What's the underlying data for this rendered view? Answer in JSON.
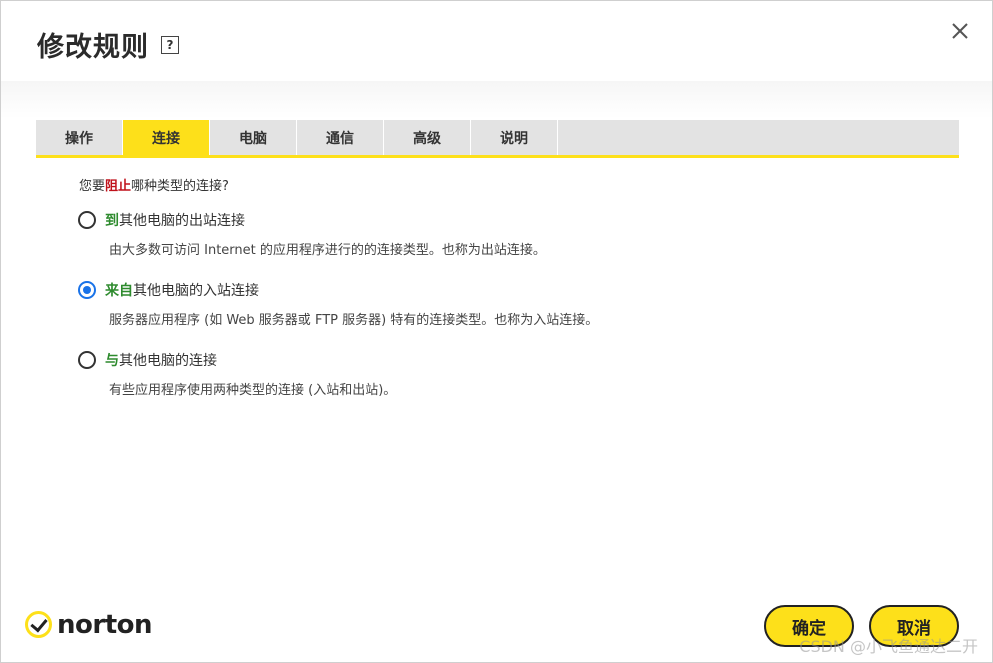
{
  "dialog": {
    "title": "修改规则",
    "help_icon": "help-icon",
    "help_glyph": "?",
    "close_icon": "close-icon"
  },
  "tabs": [
    {
      "label": "操作",
      "active": false
    },
    {
      "label": "连接",
      "active": true
    },
    {
      "label": "电脑",
      "active": false
    },
    {
      "label": "通信",
      "active": false
    },
    {
      "label": "高级",
      "active": false
    },
    {
      "label": "说明",
      "active": false
    }
  ],
  "content": {
    "question_prefix": "您要",
    "question_highlight": "阻止",
    "question_suffix": "哪种类型的连接?",
    "options": [
      {
        "highlight": "到",
        "label": "其他电脑的出站连接",
        "description": "由大多数可访问 Internet 的应用程序进行的的连接类型。也称为出站连接。",
        "selected": false
      },
      {
        "highlight": "来自",
        "label": "其他电脑的入站连接",
        "description": "服务器应用程序 (如 Web 服务器或 FTP 服务器) 特有的连接类型。也称为入站连接。",
        "selected": true
      },
      {
        "highlight": "与",
        "label": "其他电脑的连接",
        "description": "有些应用程序使用两种类型的连接 (入站和出站)。",
        "selected": false
      }
    ]
  },
  "footer": {
    "logo_text": "norton",
    "ok_label": "确定",
    "cancel_label": "取消"
  },
  "watermark": "CSDN @小飞鱼通达二开",
  "colors": {
    "accent_yellow": "#fde01a",
    "radio_selected": "#1a73e8",
    "highlight_red": "#c0121b",
    "highlight_green": "#2e8b2e"
  }
}
